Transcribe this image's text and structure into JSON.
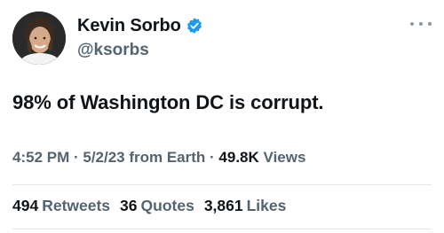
{
  "author": {
    "display_name": "Kevin Sorbo",
    "handle": "@ksorbs",
    "verified": true,
    "verified_color": "#1d9bf0"
  },
  "tweet": {
    "text": "98% of Washington DC is corrupt."
  },
  "meta": {
    "time": "4:52 PM",
    "separator1": " · ",
    "date": "5/2/23 from Earth",
    "separator2": " · ",
    "views_count": "49.8K",
    "views_label": "Views"
  },
  "stats": {
    "retweets_count": "494",
    "retweets_label": "Retweets",
    "quotes_count": "36",
    "quotes_label": "Quotes",
    "likes_count": "3,861",
    "likes_label": "Likes"
  },
  "icons": {
    "more": "more-horizontal-icon",
    "verified": "verified-badge-icon"
  }
}
